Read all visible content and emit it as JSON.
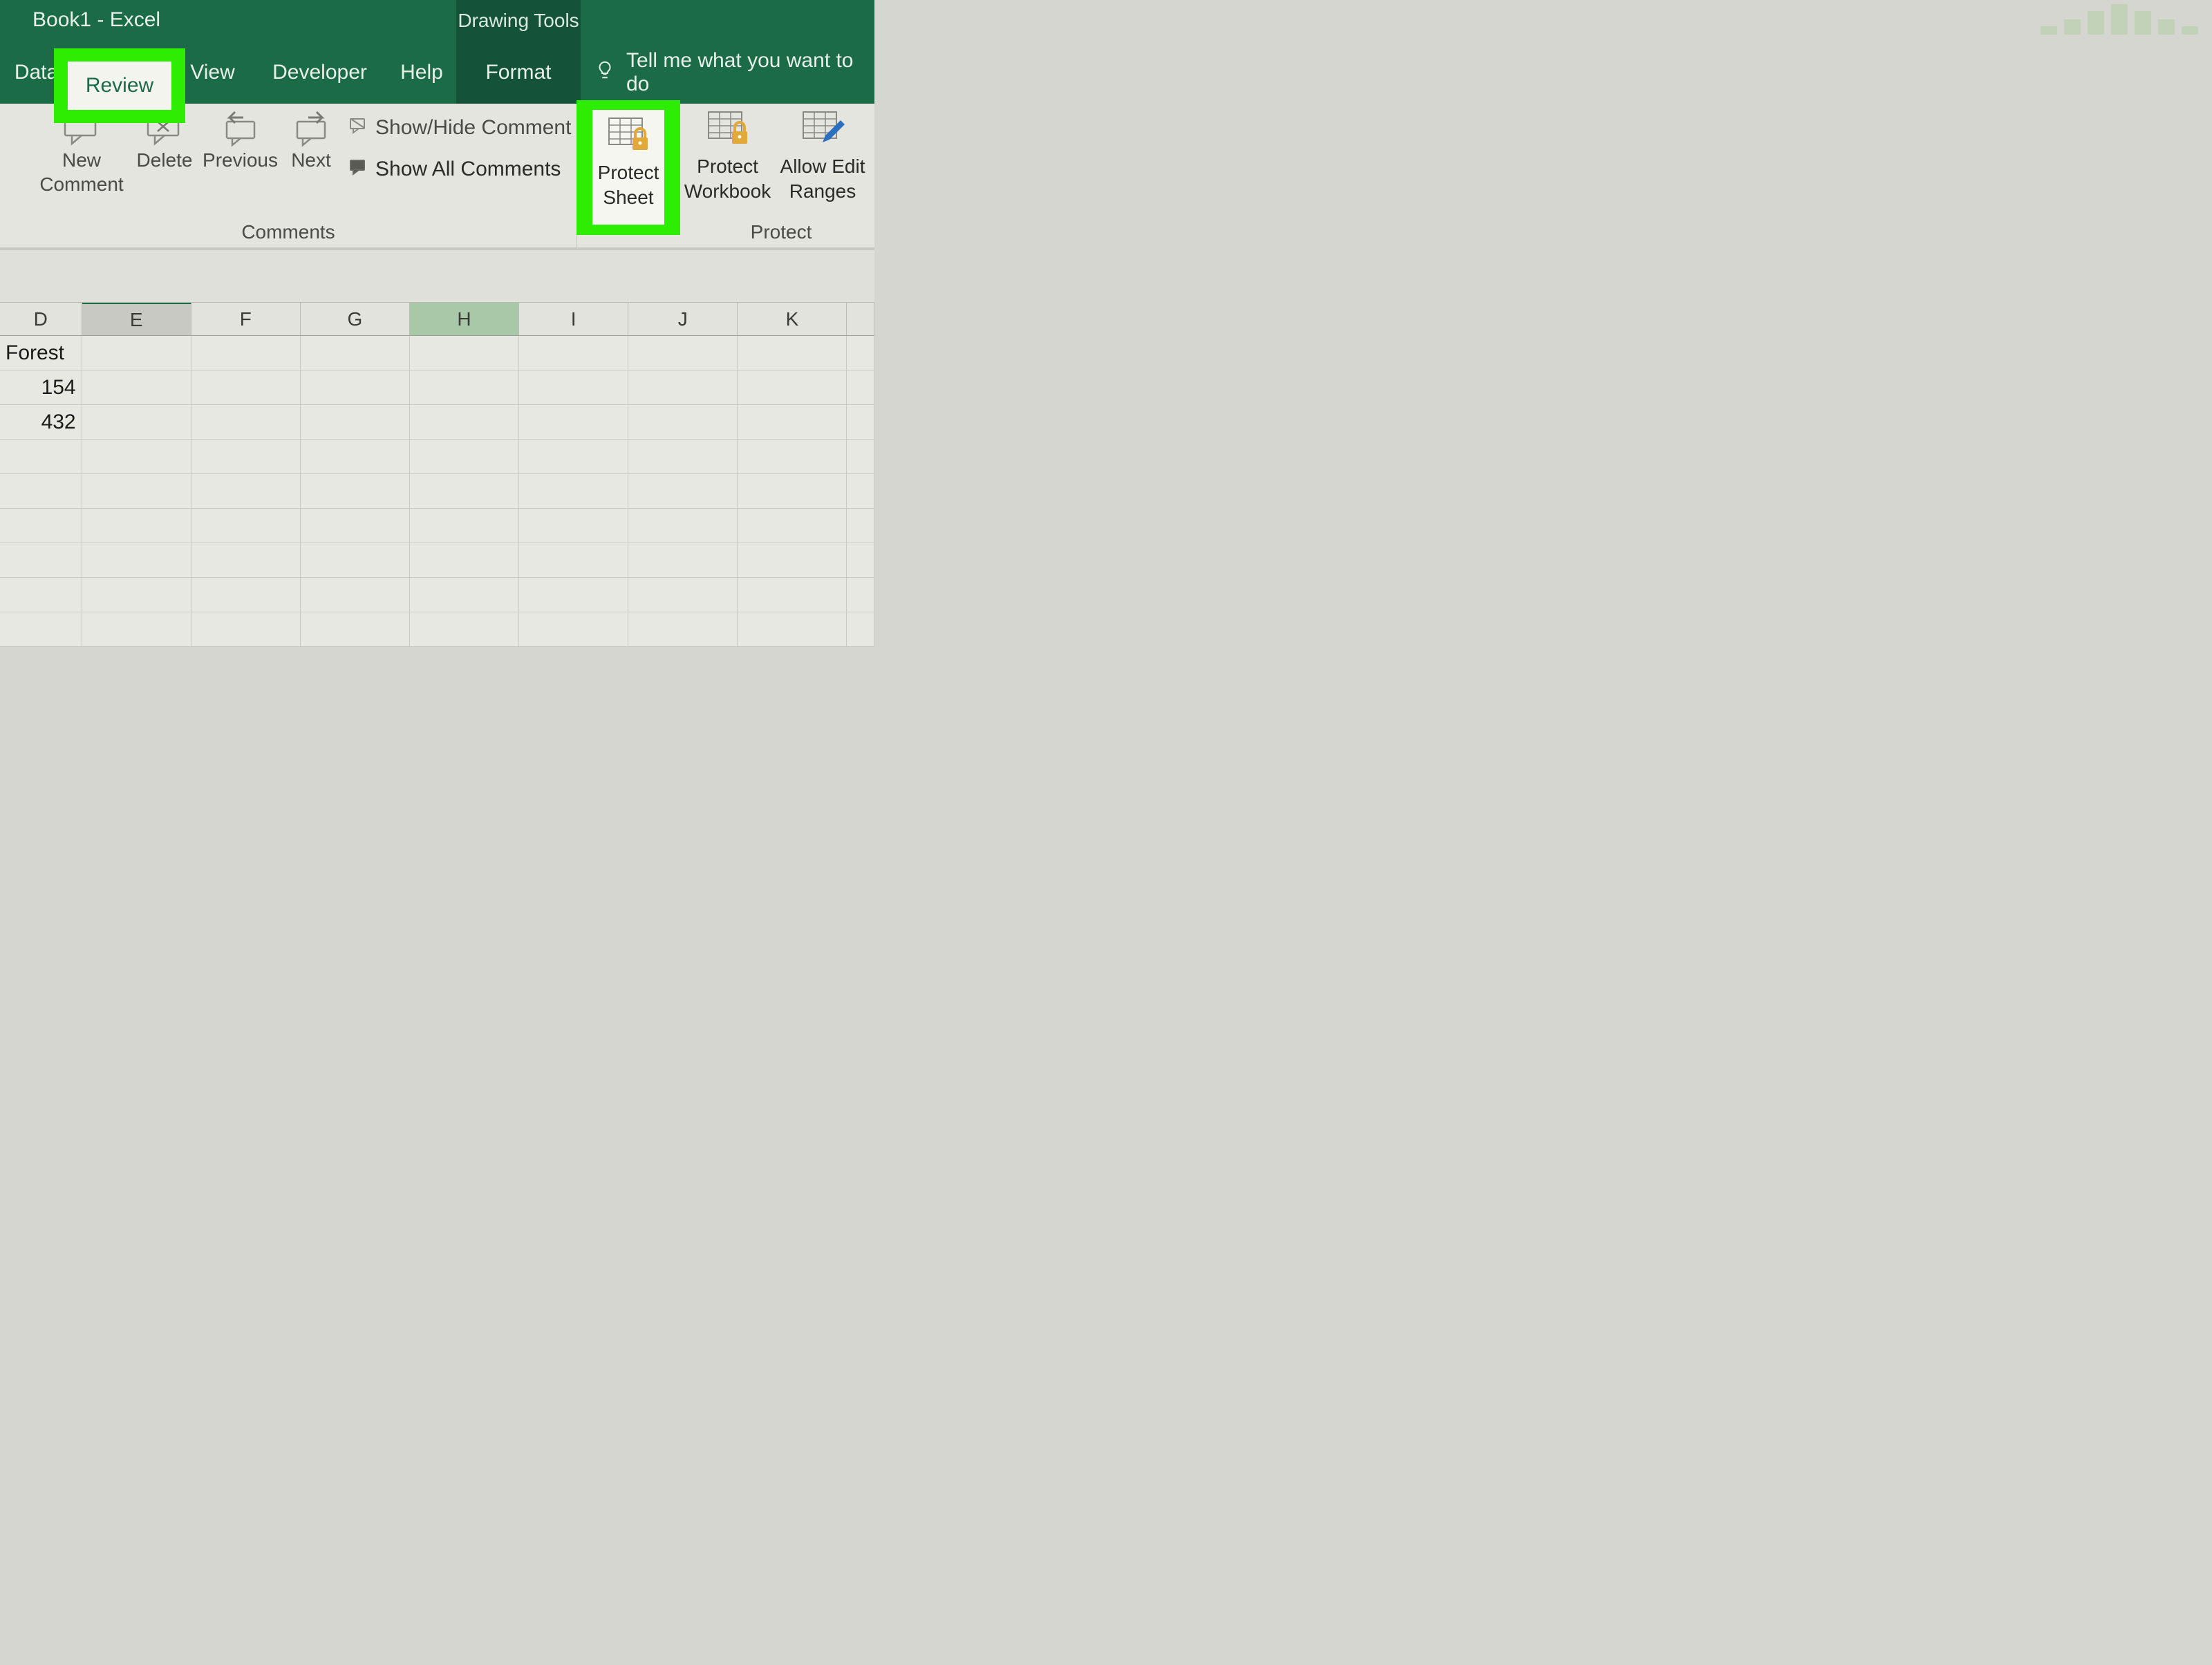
{
  "titlebar": {
    "document": "Book1  -  Excel",
    "context_tab": "Drawing Tools"
  },
  "tabs": {
    "data": "Data",
    "review": "Review",
    "view": "View",
    "developer": "Developer",
    "help": "Help",
    "format": "Format"
  },
  "tell_me": "Tell me what you want to do",
  "ribbon": {
    "comments": {
      "new": "New",
      "comment": "Comment",
      "delete": "Delete",
      "previous": "Previous",
      "next": "Next",
      "show_hide": "Show/Hide Comment",
      "show_all": "Show All Comments",
      "group_label": "Comments"
    },
    "protect": {
      "sheet1": "Protect",
      "sheet2": "Sheet",
      "workbook1": "Protect",
      "workbook2": "Workbook",
      "ranges1": "Allow Edit",
      "ranges2": "Ranges",
      "group_label": "Protect"
    }
  },
  "columns": [
    "D",
    "E",
    "F",
    "G",
    "H",
    "I",
    "J",
    "K"
  ],
  "cells": {
    "D1": "Forest",
    "D2": "154",
    "D3": "432"
  }
}
